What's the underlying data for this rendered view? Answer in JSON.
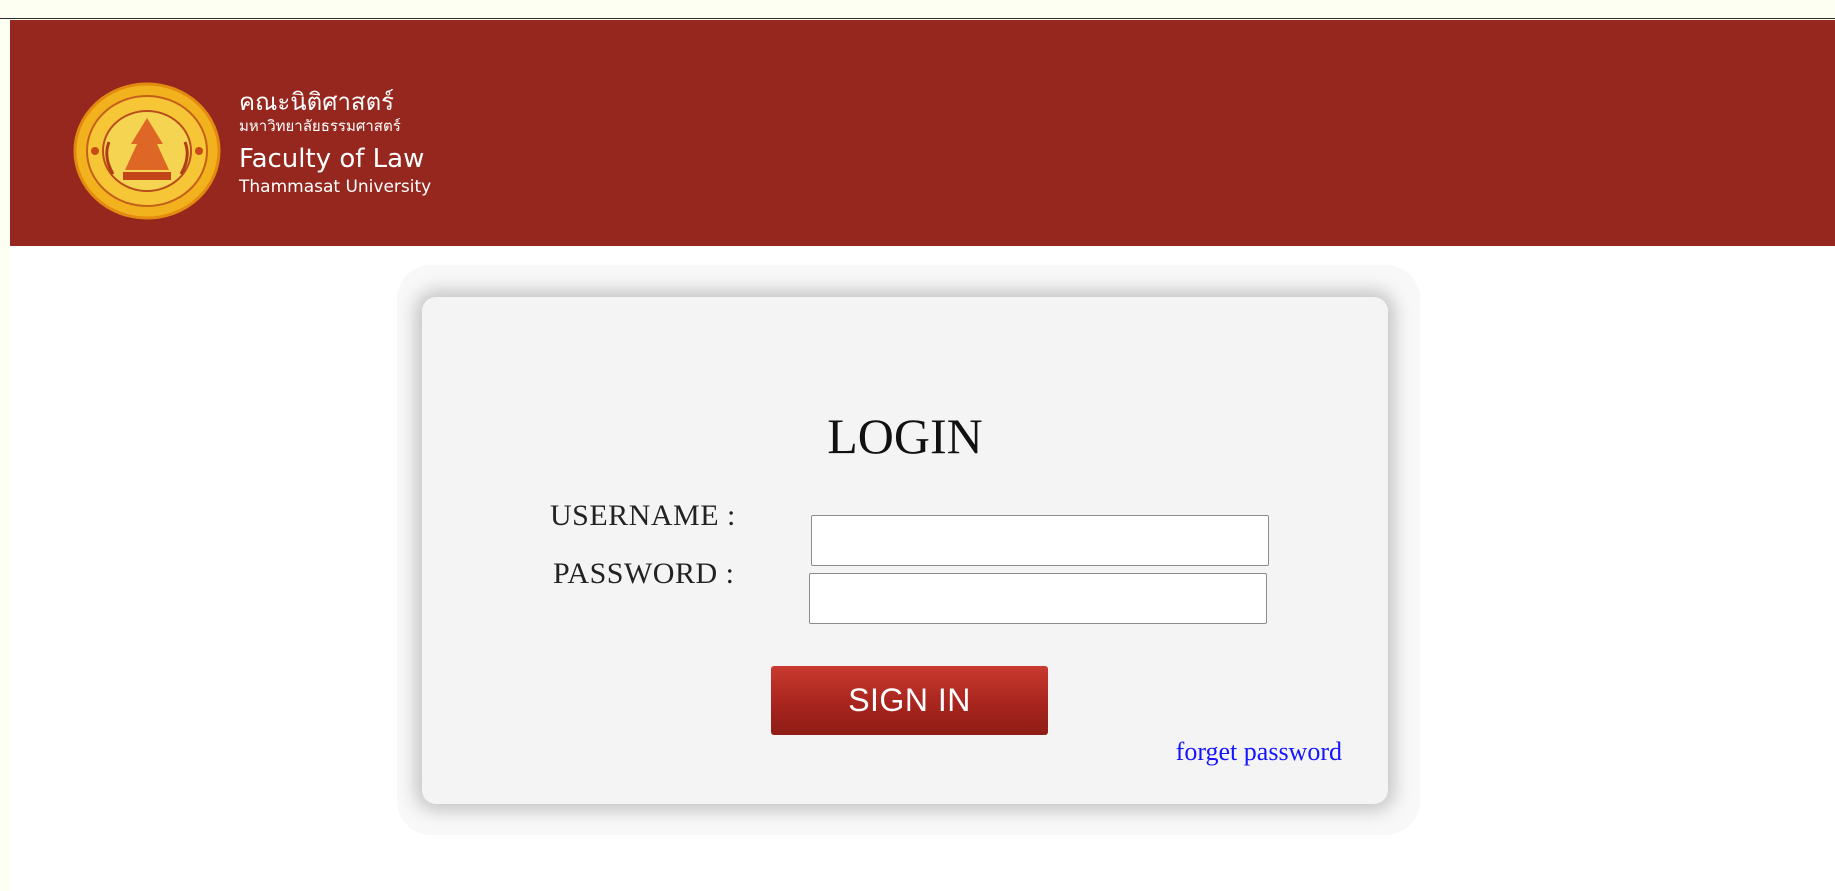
{
  "header": {
    "name_th": "คณะนิติศาสตร์",
    "university_th": "มหาวิทยาลัยธรรมศาสตร์",
    "name_en": "Faculty of Law",
    "university_en": "Thammasat University",
    "brand_color": "#95271e",
    "logo_icon": "thammasat-seal-icon"
  },
  "login": {
    "title": "LOGIN",
    "username_label": "USERNAME :",
    "password_label": "PASSWORD :",
    "username_value": "",
    "password_value": "",
    "signin_label": "SIGN IN",
    "forget_label": "forget password",
    "link_color": "#1515ff"
  }
}
